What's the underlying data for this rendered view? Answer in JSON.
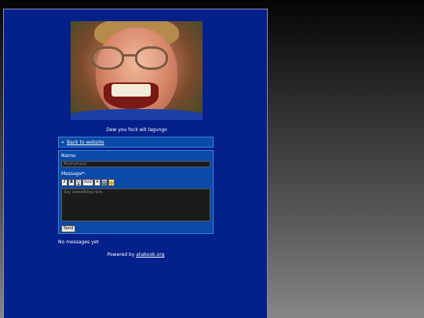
{
  "caption": "Dew you fock wit lagungo",
  "back_link": {
    "arrow": "«",
    "label": "Back to website"
  },
  "form": {
    "name_label": "Name:",
    "name_placeholder": "Anonymous",
    "message_label": "Message*:",
    "message_placeholder": "Say something nice.",
    "send_label": "Send",
    "toolbar": [
      {
        "icon": "italic-icon",
        "label": "I"
      },
      {
        "icon": "bold-icon",
        "label": "B"
      },
      {
        "icon": "underline-icon",
        "label": "U"
      },
      {
        "icon": "font-icon",
        "label": "font"
      },
      {
        "icon": "text-size-icon",
        "label": "A"
      },
      {
        "icon": "image-icon",
        "label": ""
      },
      {
        "icon": "smiley-icon",
        "label": ""
      }
    ]
  },
  "no_messages": "No messages yet",
  "footer": {
    "prefix": "Powered by ",
    "link": "atabook.org"
  }
}
